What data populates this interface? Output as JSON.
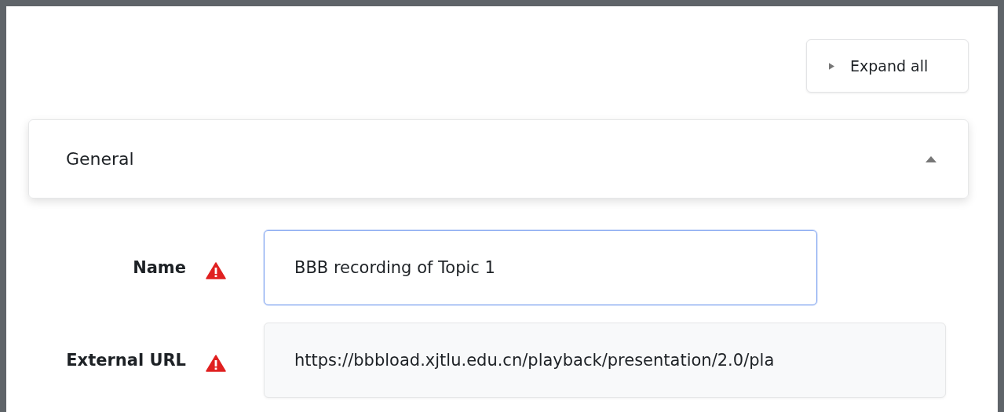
{
  "expand_all": {
    "label": "Expand all",
    "expanded": false
  },
  "section": {
    "title": "General",
    "expanded": true
  },
  "fields": [
    {
      "label": "Name",
      "required": true,
      "value": "BBB recording of Topic 1",
      "focused": true,
      "readonly": false
    },
    {
      "label": "External URL",
      "required": true,
      "value": "https://bbbload.xjtlu.edu.cn/playback/presentation/2.0/pla",
      "focused": false,
      "readonly": true
    }
  ]
}
